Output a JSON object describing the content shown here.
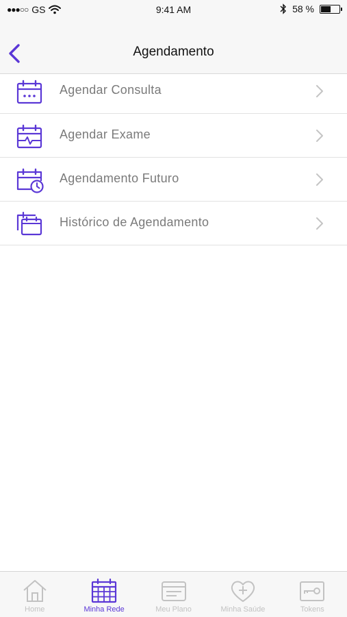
{
  "status_bar": {
    "signal": "●●●○○",
    "carrier": "GS",
    "time": "9:41 AM",
    "battery": "58 %",
    "battery_level": 0.58
  },
  "header": {
    "title": "Agendamento"
  },
  "menu": {
    "items": [
      {
        "label": "Agendar Consulta",
        "icon": "calendar-dots-icon"
      },
      {
        "label": "Agendar Exame",
        "icon": "calendar-pulse-icon"
      },
      {
        "label": "Agendamento Futuro",
        "icon": "calendar-clock-icon"
      },
      {
        "label": "Histórico de Agendamento",
        "icon": "calendar-history-icon"
      }
    ]
  },
  "tab_bar": {
    "tabs": [
      {
        "label": "Home",
        "icon": "home-icon",
        "active": false
      },
      {
        "label": "Minha Rede",
        "icon": "grid-calendar-icon",
        "active": true
      },
      {
        "label": "Meu Plano",
        "icon": "card-icon",
        "active": false
      },
      {
        "label": "Minha Saúde",
        "icon": "heart-plus-icon",
        "active": false
      },
      {
        "label": "Tokens",
        "icon": "key-icon",
        "active": false
      }
    ]
  },
  "colors": {
    "accent": "#5a37d6",
    "inactive": "#c2c2c2",
    "label_gray": "#7a7a7a"
  }
}
